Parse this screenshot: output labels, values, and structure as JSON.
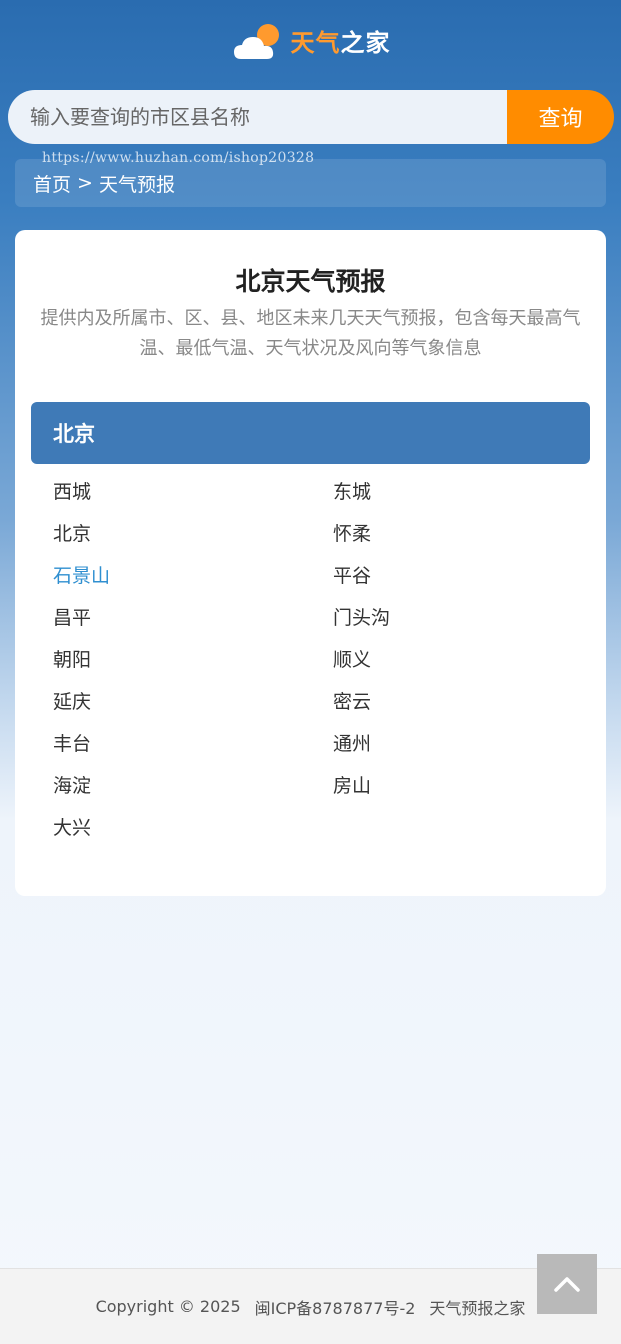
{
  "header": {
    "logo_text_part1": "天气",
    "logo_text_part2": "之家",
    "brand_orange": "#ff9a2e"
  },
  "search": {
    "placeholder": "输入要查询的市区县名称",
    "button_label": "查询",
    "button_color": "#ff8c00"
  },
  "watermark": "https://www.huzhan.com/ishop20328",
  "breadcrumb": {
    "home": "首页",
    "separator": ">",
    "current": "天气预报"
  },
  "card": {
    "title": "北京天气预报",
    "description": "提供内及所属市、区、县、地区未来几天天气预报，包含每天最高气温、最低气温、天气状况及风向等气象信息"
  },
  "region": {
    "name": "北京",
    "header_color": "#3f7ab7",
    "cities": [
      "西城",
      "东城",
      "北京",
      "怀柔",
      "石景山",
      "平谷",
      "昌平",
      "门头沟",
      "朝阳",
      "顺义",
      "延庆",
      "密云",
      "丰台",
      "通州",
      "海淀",
      "房山",
      "大兴"
    ],
    "active_city": "石景山",
    "active_color": "#2f8fd0"
  },
  "footer": {
    "copyright": "Copyright © 2025",
    "icp": "闽ICP备8787877号-2",
    "site_name": "天气预报之家"
  },
  "back_to_top_icon": "chevron-up-icon"
}
